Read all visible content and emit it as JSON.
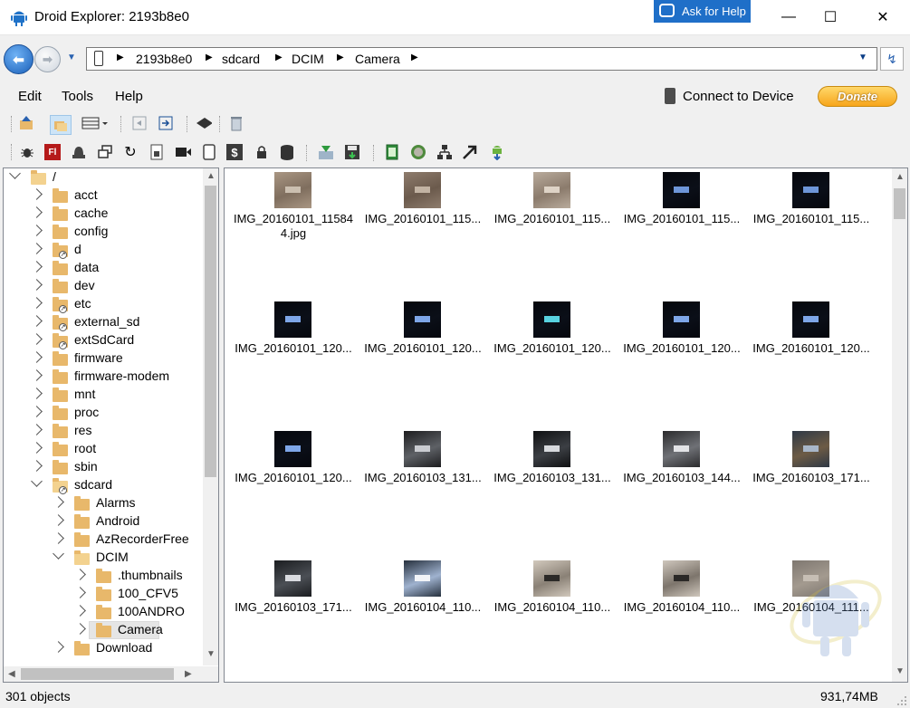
{
  "window": {
    "title": "Droid Explorer: 2193b8e0",
    "help_button": "Ask for Help",
    "minimize_glyph": "—",
    "maximize_glyph": "☐",
    "close_glyph": "✕"
  },
  "address": {
    "back_glyph": "⬅",
    "forward_glyph": "➡",
    "crumbs": [
      "2193b8e0",
      "sdcard",
      "DCIM",
      "Camera"
    ],
    "separator_glyph": "▶",
    "dropdown_glyph": "▼",
    "refresh_glyph": "↯"
  },
  "menu": {
    "edit": "Edit",
    "tools": "Tools",
    "help": "Help",
    "connect": "Connect to Device",
    "donate": "Donate"
  },
  "toolbar1_icons": [
    "up-folder-icon",
    "copy-folder-icon",
    "view-mode-icon",
    "collapse-icon",
    "expand-icon",
    "shell-icon",
    "recycle-icon"
  ],
  "toolbar2_icons": [
    "bug-icon",
    "flash-icon",
    "alarm-icon",
    "windows-icon",
    "refresh-icon",
    "apk-icon",
    "camera-icon",
    "device-icon",
    "dollar-icon",
    "lock-icon",
    "database-icon",
    "install-icon",
    "save-icon",
    "battery-icon",
    "globe-icon",
    "network-icon",
    "arrow-icon",
    "download-icon"
  ],
  "tree": [
    {
      "label": "/",
      "depth": 0,
      "state": "open",
      "type": "folder"
    },
    {
      "label": "acct",
      "depth": 1,
      "state": "closed",
      "type": "folder"
    },
    {
      "label": "cache",
      "depth": 1,
      "state": "closed",
      "type": "folder"
    },
    {
      "label": "config",
      "depth": 1,
      "state": "closed",
      "type": "folder"
    },
    {
      "label": "d",
      "depth": 1,
      "state": "closed",
      "type": "link"
    },
    {
      "label": "data",
      "depth": 1,
      "state": "closed",
      "type": "folder"
    },
    {
      "label": "dev",
      "depth": 1,
      "state": "closed",
      "type": "folder"
    },
    {
      "label": "etc",
      "depth": 1,
      "state": "closed",
      "type": "link"
    },
    {
      "label": "external_sd",
      "depth": 1,
      "state": "closed",
      "type": "link"
    },
    {
      "label": "extSdCard",
      "depth": 1,
      "state": "closed",
      "type": "link"
    },
    {
      "label": "firmware",
      "depth": 1,
      "state": "closed",
      "type": "folder"
    },
    {
      "label": "firmware-modem",
      "depth": 1,
      "state": "closed",
      "type": "folder"
    },
    {
      "label": "mnt",
      "depth": 1,
      "state": "closed",
      "type": "folder"
    },
    {
      "label": "proc",
      "depth": 1,
      "state": "closed",
      "type": "folder"
    },
    {
      "label": "res",
      "depth": 1,
      "state": "closed",
      "type": "folder"
    },
    {
      "label": "root",
      "depth": 1,
      "state": "closed",
      "type": "folder"
    },
    {
      "label": "sbin",
      "depth": 1,
      "state": "closed",
      "type": "folder"
    },
    {
      "label": "sdcard",
      "depth": 1,
      "state": "open",
      "type": "link"
    },
    {
      "label": "Alarms",
      "depth": 2,
      "state": "closed",
      "type": "folder"
    },
    {
      "label": "Android",
      "depth": 2,
      "state": "closed",
      "type": "folder"
    },
    {
      "label": "AzRecorderFree",
      "depth": 2,
      "state": "closed",
      "type": "folder"
    },
    {
      "label": "DCIM",
      "depth": 2,
      "state": "open",
      "type": "folder"
    },
    {
      "label": ".thumbnails",
      "depth": 3,
      "state": "closed",
      "type": "folder"
    },
    {
      "label": "100_CFV5",
      "depth": 3,
      "state": "closed",
      "type": "folder"
    },
    {
      "label": "100ANDRO",
      "depth": 3,
      "state": "closed",
      "type": "folder"
    },
    {
      "label": "Camera",
      "depth": 3,
      "state": "closed",
      "type": "folder",
      "selected": true
    },
    {
      "label": "Download",
      "depth": 2,
      "state": "closed",
      "type": "folder"
    }
  ],
  "files": [
    {
      "name": "IMG_20160101_115844.jpg",
      "line1": "IMG_20160101_11584",
      "line2": "4.jpg",
      "palette": [
        "#a99683",
        "#7f6e5e",
        "#cbbfb0"
      ]
    },
    {
      "name": "IMG_20160101_115...",
      "palette": [
        "#8e7c6d",
        "#6b5a4c",
        "#c2b3a3"
      ]
    },
    {
      "name": "IMG_20160101_115...",
      "palette": [
        "#b9ab9c",
        "#8b7b6c",
        "#ded3c6"
      ]
    },
    {
      "name": "IMG_20160101_115...",
      "palette": [
        "#05070d",
        "#0b0f18",
        "#6e96d8"
      ]
    },
    {
      "name": "IMG_20160101_115...",
      "palette": [
        "#05070d",
        "#0b0f18",
        "#6e96d8"
      ]
    },
    {
      "name": "IMG_20160101_120...",
      "palette": [
        "#05070d",
        "#0b0f18",
        "#7ea6e8"
      ]
    },
    {
      "name": "IMG_20160101_120...",
      "palette": [
        "#05070d",
        "#0b0f18",
        "#7ea6e8"
      ]
    },
    {
      "name": "IMG_20160101_120...",
      "palette": [
        "#05070d",
        "#0b0f18",
        "#58d2e0"
      ]
    },
    {
      "name": "IMG_20160101_120...",
      "palette": [
        "#05070d",
        "#0b0f18",
        "#7ea6e8"
      ]
    },
    {
      "name": "IMG_20160101_120...",
      "palette": [
        "#05070d",
        "#0b0f18",
        "#7ea6e8"
      ]
    },
    {
      "name": "IMG_20160101_120...",
      "palette": [
        "#05070d",
        "#0b0f18",
        "#7ea6e8"
      ]
    },
    {
      "name": "IMG_20160103_131...",
      "palette": [
        "#1d1d1f",
        "#5e6166",
        "#c9cbd0"
      ]
    },
    {
      "name": "IMG_20160103_131...",
      "palette": [
        "#0f1012",
        "#3c3f44",
        "#d7d9dd"
      ]
    },
    {
      "name": "IMG_20160103_144...",
      "palette": [
        "#2b2b2d",
        "#6f7176",
        "#e2e3e6"
      ]
    },
    {
      "name": "IMG_20160103_171...",
      "palette": [
        "#2e3845",
        "#6d5b45",
        "#a8b6c8"
      ]
    },
    {
      "name": "IMG_20160103_171...",
      "palette": [
        "#1b1d20",
        "#4b4f55",
        "#d9dbe0"
      ]
    },
    {
      "name": "IMG_20160104_110...",
      "palette": [
        "#26303d",
        "#9fb2cf",
        "#f2f4f8"
      ]
    },
    {
      "name": "IMG_20160104_110...",
      "palette": [
        "#d2c9bd",
        "#8a8176",
        "#2c2a28"
      ]
    },
    {
      "name": "IMG_20160104_110...",
      "palette": [
        "#cfc7bd",
        "#7d756c",
        "#2b2927"
      ]
    },
    {
      "name": "IMG_20160104_111...",
      "palette": [
        "#7e7770",
        "#a39a8f",
        "#c6beb4"
      ]
    }
  ],
  "status": {
    "count": "301 objects",
    "size": "931,74MB"
  }
}
